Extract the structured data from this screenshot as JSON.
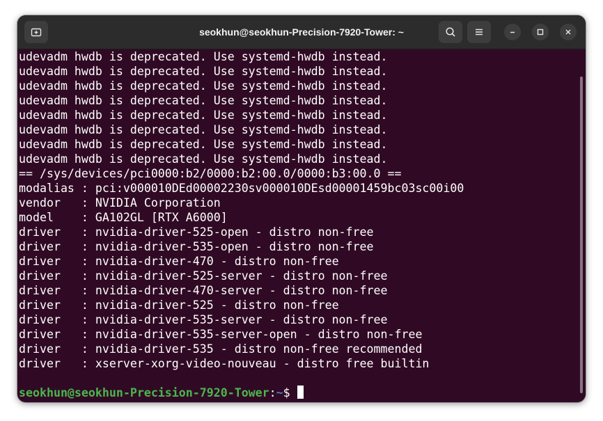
{
  "window": {
    "title": "seokhun@seokhun-Precision-7920-Tower: ~"
  },
  "icons": {
    "new_tab": "new-tab-icon",
    "search": "search-icon",
    "menu": "hamburger-menu-icon",
    "minimize": "minimize-icon",
    "maximize": "maximize-icon",
    "close": "close-icon"
  },
  "colors": {
    "terminal_bg": "#300a24",
    "titlebar_bg": "#2c2c2c",
    "prompt_user": "#4cb64e",
    "prompt_path": "#4d7cd1"
  },
  "terminal": {
    "lines": [
      "udevadm hwdb is deprecated. Use systemd-hwdb instead.",
      "udevadm hwdb is deprecated. Use systemd-hwdb instead.",
      "udevadm hwdb is deprecated. Use systemd-hwdb instead.",
      "udevadm hwdb is deprecated. Use systemd-hwdb instead.",
      "udevadm hwdb is deprecated. Use systemd-hwdb instead.",
      "udevadm hwdb is deprecated. Use systemd-hwdb instead.",
      "udevadm hwdb is deprecated. Use systemd-hwdb instead.",
      "udevadm hwdb is deprecated. Use systemd-hwdb instead.",
      "== /sys/devices/pci0000:b2/0000:b2:00.0/0000:b3:00.0 ==",
      "modalias : pci:v000010DEd00002230sv000010DEsd00001459bc03sc00i00",
      "vendor   : NVIDIA Corporation",
      "model    : GA102GL [RTX A6000]",
      "driver   : nvidia-driver-525-open - distro non-free",
      "driver   : nvidia-driver-535-open - distro non-free",
      "driver   : nvidia-driver-470 - distro non-free",
      "driver   : nvidia-driver-525-server - distro non-free",
      "driver   : nvidia-driver-470-server - distro non-free",
      "driver   : nvidia-driver-525 - distro non-free",
      "driver   : nvidia-driver-535-server - distro non-free",
      "driver   : nvidia-driver-535-server-open - distro non-free",
      "driver   : nvidia-driver-535 - distro non-free recommended",
      "driver   : xserver-xorg-video-nouveau - distro free builtin",
      ""
    ],
    "prompt": {
      "user_host": "seokhun@seokhun-Precision-7920-Tower",
      "separator": ":",
      "path": "~",
      "symbol": "$ "
    }
  }
}
